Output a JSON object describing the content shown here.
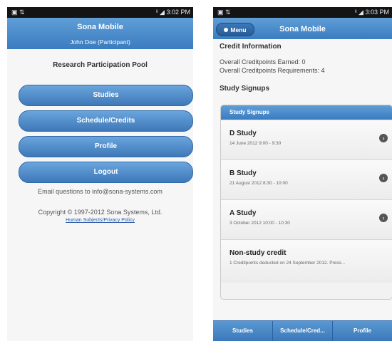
{
  "left": {
    "statusbar": {
      "left": "▣ ⇅",
      "right": "ⁱˡ ◢ 3:02 PM"
    },
    "header": {
      "title": "Sona Mobile",
      "subtitle": "John Doe (Participant)"
    },
    "pool_title": "Research Participation Pool",
    "buttons": [
      "Studies",
      "Schedule/Credits",
      "Profile",
      "Logout"
    ],
    "email_text": "Email questions to info@sona-systems.com",
    "copyright": "Copyright © 1997-2012 Sona Systems, Ltd.",
    "policy_link": "Human Subjects/Privacy Policy"
  },
  "right": {
    "statusbar": {
      "left": "▣ ⇅",
      "right": "ⁱˡ ◢ 3:03 PM"
    },
    "header": {
      "menu_label": "Menu",
      "title": "Sona Mobile"
    },
    "credit": {
      "title": "Credit Information",
      "earned": "Overall Creditpoints Earned: 0",
      "required": "Overall Creditpoints Requirements: 4"
    },
    "signups_title": "Study Signups",
    "list_header": "Study Signups",
    "studies": [
      {
        "name": "D Study",
        "date": "14 June 2012 9:00 - 9:30"
      },
      {
        "name": "B Study",
        "date": "21 August 2012 8:30 - 10:00"
      },
      {
        "name": "A Study",
        "date": "3 October 2012 10:00 - 10:30"
      },
      {
        "name": "Non-study credit",
        "date": "1 Creditpoints deducted on 24 September 2012. Press..."
      }
    ],
    "tabs": [
      "Studies",
      "Schedule/Cred...",
      "Profile"
    ]
  },
  "colors": {
    "accent": "#3f7cc0",
    "statusbar": "#141414"
  },
  "icons": {
    "row_arrow": "chevron-right-circle-icon",
    "menu_dot": "menu-dot-icon"
  }
}
